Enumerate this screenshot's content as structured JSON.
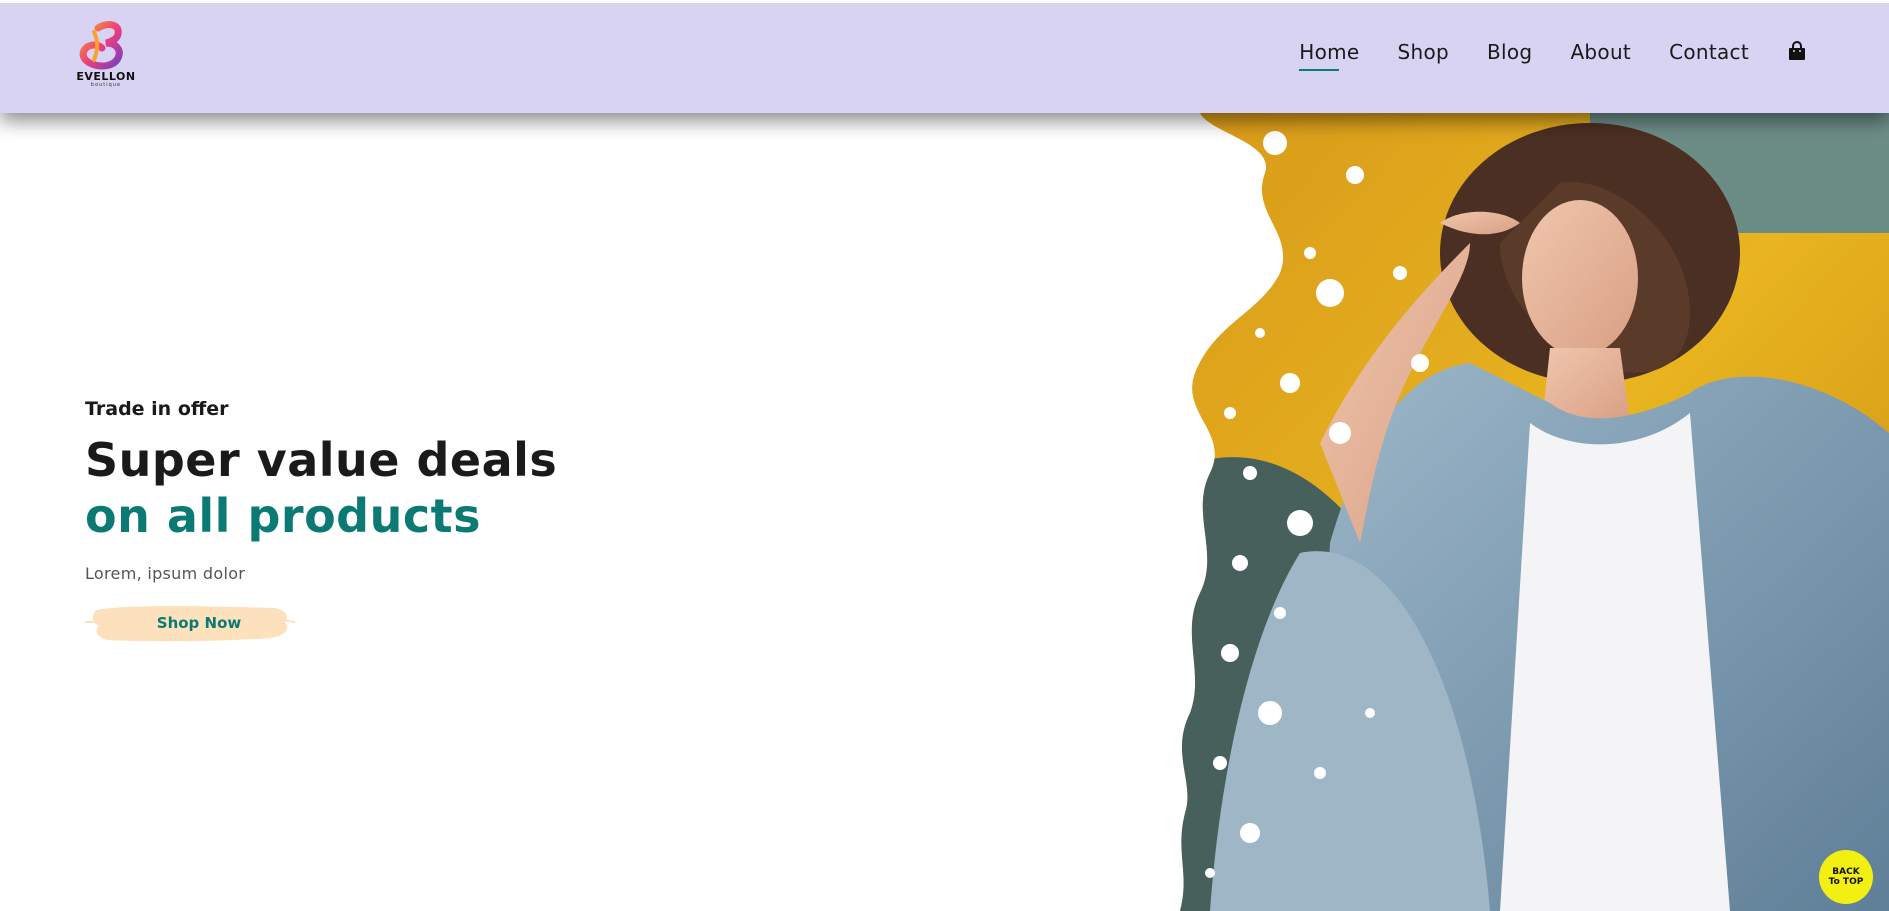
{
  "brand": {
    "name": "EVELLON",
    "tagline": "boutique",
    "logo_icon": "b-swirl-logo"
  },
  "nav": {
    "items": [
      {
        "label": "Home",
        "active": true
      },
      {
        "label": "Shop",
        "active": false
      },
      {
        "label": "Blog",
        "active": false
      },
      {
        "label": "About",
        "active": false
      },
      {
        "label": "Contact",
        "active": false
      }
    ],
    "cart_icon": "shopping-bag-icon"
  },
  "hero": {
    "eyebrow": "Trade in offer",
    "title_line1": "Super value deals",
    "title_line2": "on all products",
    "subtitle": "Lorem, ipsum dolor",
    "cta_label": "Shop Now",
    "image_alt": "hero-model-photo"
  },
  "back_to_top": {
    "line1": "BACK",
    "line2": "To TOP"
  },
  "colors": {
    "header_bg": "#d8d3f3",
    "accent": "#0b7a73",
    "cta_brush": "#fde1bd",
    "back_to_top_bg": "#f2ef13"
  }
}
